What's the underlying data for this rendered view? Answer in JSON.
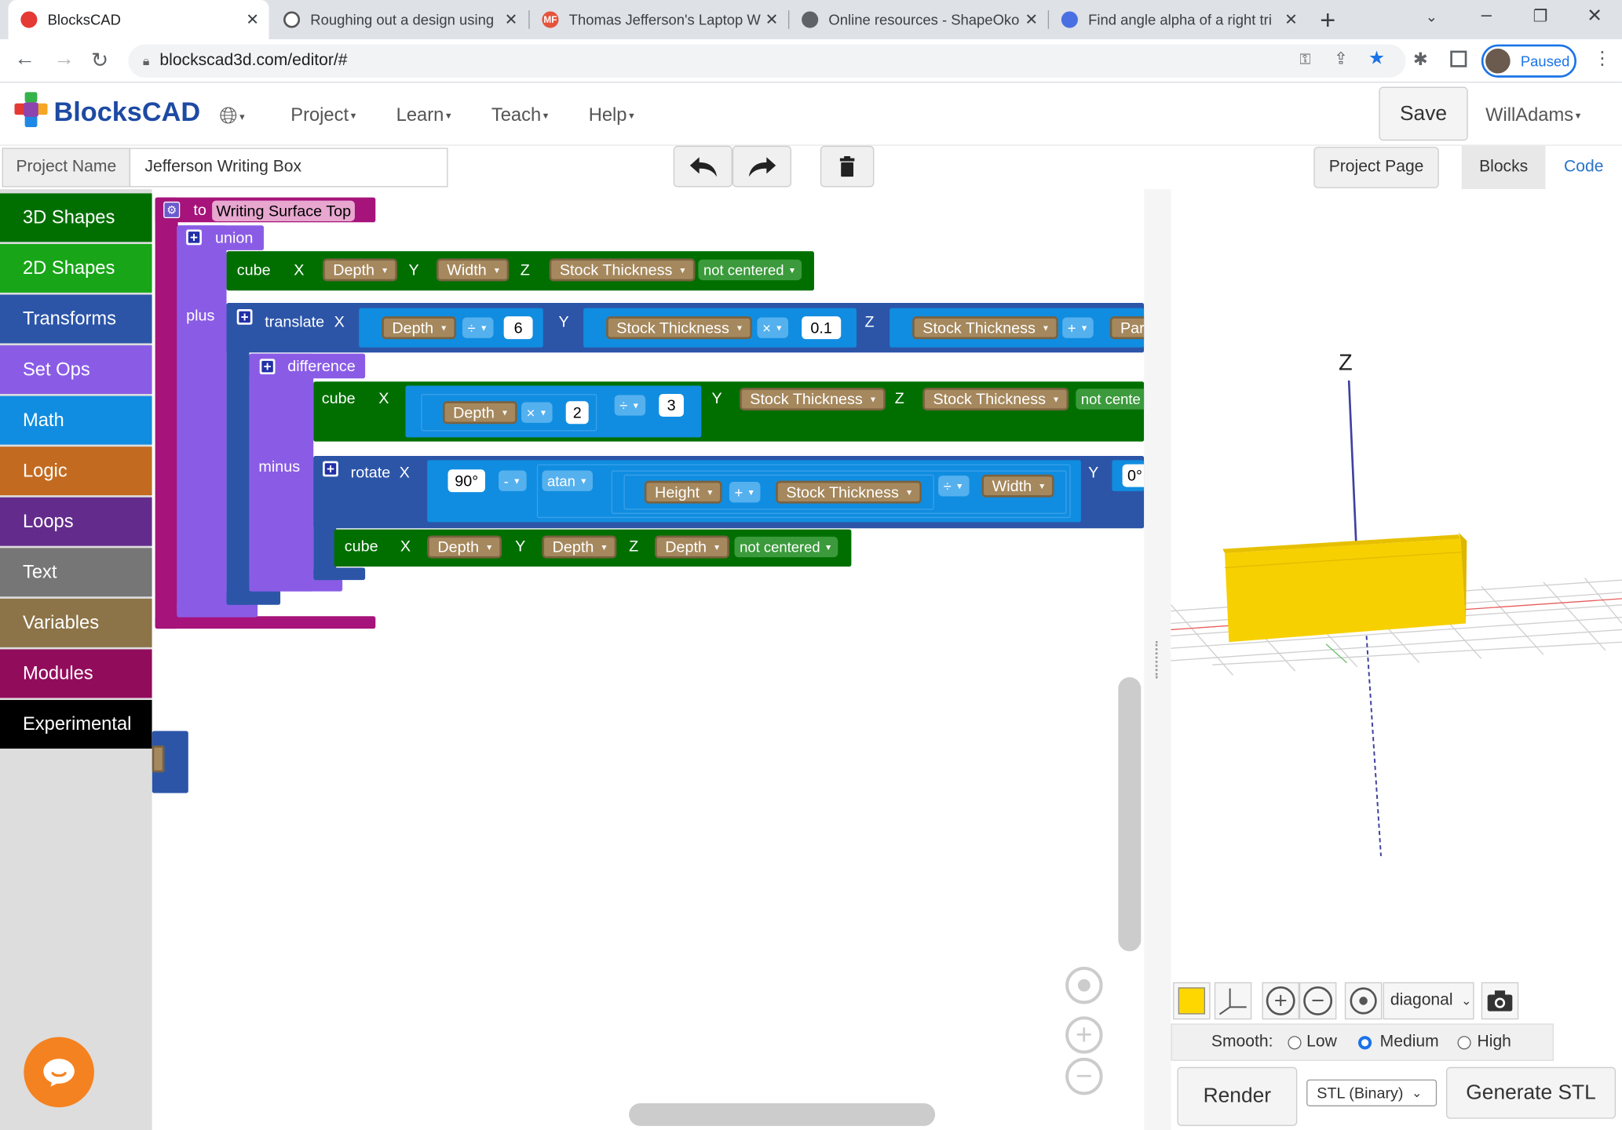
{
  "browser": {
    "tabs": [
      {
        "title": "BlocksCAD",
        "active": true
      },
      {
        "title": "Roughing out a design using",
        "active": false
      },
      {
        "title": "Thomas Jefferson's Laptop W",
        "active": false
      },
      {
        "title": "Online resources - ShapeOko",
        "active": false
      },
      {
        "title": "Find angle alpha of a right tri",
        "active": false
      }
    ],
    "url": "blockscad3d.com/editor/#",
    "profile_label": "Paused"
  },
  "app": {
    "logo_text": "BlocksCAD",
    "menu": [
      "Project",
      "Learn",
      "Teach",
      "Help"
    ],
    "save_label": "Save",
    "user": "WillAdams"
  },
  "project": {
    "name_label": "Project Name",
    "name_value": "Jefferson Writing Box",
    "project_page": "Project Page",
    "view_tabs": {
      "blocks": "Blocks",
      "code": "Code"
    }
  },
  "palette": [
    {
      "label": "3D Shapes",
      "color": "#006f00"
    },
    {
      "label": "2D Shapes",
      "color": "#18a618"
    },
    {
      "label": "Transforms",
      "color": "#2c55a8"
    },
    {
      "label": "Set Ops",
      "color": "#8a5ce6"
    },
    {
      "label": "Math",
      "color": "#108de0"
    },
    {
      "label": "Logic",
      "color": "#c26b20"
    },
    {
      "label": "Loops",
      "color": "#632c8c"
    },
    {
      "label": "Text",
      "color": "#767676"
    },
    {
      "label": "Variables",
      "color": "#8c7448"
    },
    {
      "label": "Modules",
      "color": "#920c5c"
    },
    {
      "label": "Experimental",
      "color": "#000000"
    }
  ],
  "blocks": {
    "to": "to",
    "module_name": "Writing Surface Top",
    "union": "union",
    "plus": "plus",
    "difference": "difference",
    "minus": "minus",
    "cube": "cube",
    "translate": "translate",
    "rotate": "rotate",
    "x": "X",
    "y": "Y",
    "z": "Z",
    "depth": "Depth",
    "width": "Width",
    "height": "Height",
    "stock": "Stock Thickness",
    "not_centered": "not centered",
    "not_cente": "not cente",
    "part": "Part",
    "atan": "atan",
    "op_div": "÷",
    "op_mul": "×",
    "op_plus": "+",
    "op_minus": "-",
    "n6": "6",
    "n01": "0.1",
    "n2": "2",
    "n3": "3",
    "deg90": "90°",
    "deg0": "0°"
  },
  "viewer": {
    "axis_label": "Z",
    "view_select": "diagonal",
    "smooth_label": "Smooth:",
    "smooth_options": [
      "Low",
      "Medium",
      "High"
    ],
    "smooth_selected": "Medium",
    "render": "Render",
    "format": "STL (Binary)",
    "generate": "Generate STL",
    "part_color": "#ffd700"
  }
}
